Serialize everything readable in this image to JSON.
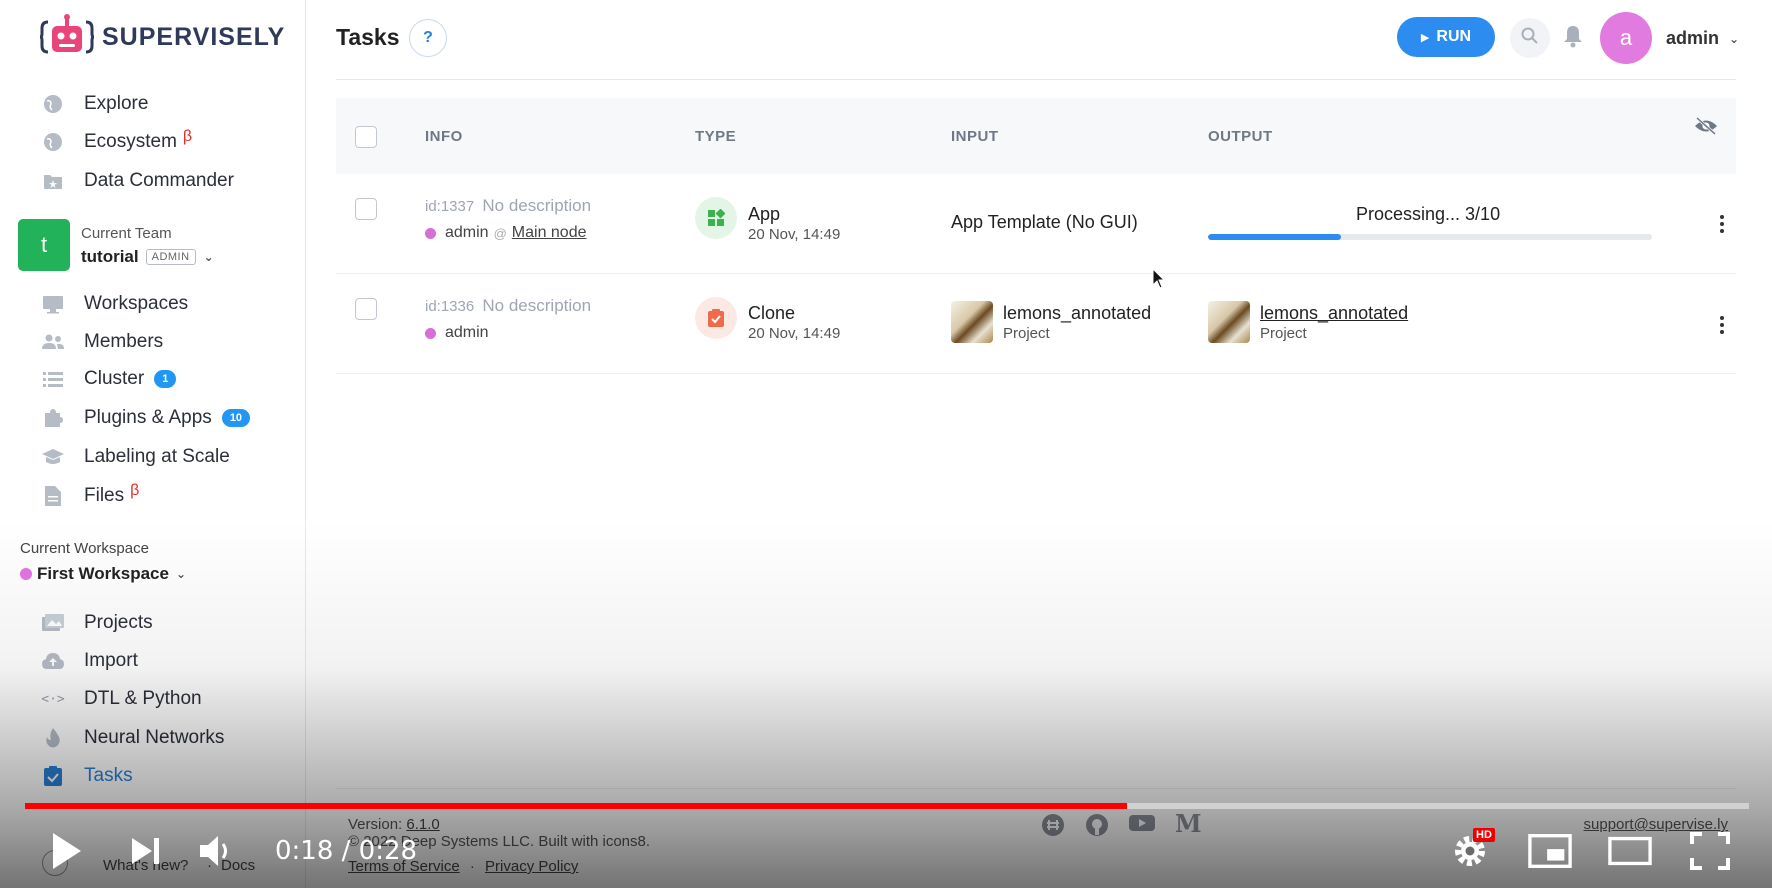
{
  "brand": {
    "name": "SUPERVISELY"
  },
  "nav_top": [
    {
      "label": "Explore",
      "icon": "globe-icon"
    },
    {
      "label": "Ecosystem",
      "icon": "globe-icon",
      "beta": "β"
    },
    {
      "label": "Data Commander",
      "icon": "folder-star-icon"
    }
  ],
  "team": {
    "caption": "Current Team",
    "name": "tutorial",
    "role": "ADMIN",
    "avatar": "t"
  },
  "nav_team": [
    {
      "label": "Workspaces",
      "icon": "monitor-icon"
    },
    {
      "label": "Members",
      "icon": "people-icon"
    },
    {
      "label": "Cluster",
      "icon": "list-icon",
      "count": "1"
    },
    {
      "label": "Plugins & Apps",
      "icon": "puzzle-icon",
      "count": "10"
    },
    {
      "label": "Labeling at Scale",
      "icon": "graduation-cap-icon"
    },
    {
      "label": "Files",
      "icon": "file-icon",
      "beta": "β"
    }
  ],
  "workspace": {
    "caption": "Current Workspace",
    "name": "First Workspace"
  },
  "nav_ws": [
    {
      "label": "Projects",
      "icon": "images-icon"
    },
    {
      "label": "Import",
      "icon": "cloud-upload-icon"
    },
    {
      "label": "DTL & Python",
      "icon": "code-icon"
    },
    {
      "label": "Neural Networks",
      "icon": "flame-icon"
    },
    {
      "label": "Tasks",
      "icon": "clipboard-check-icon",
      "active": true
    }
  ],
  "sidebar_footer": {
    "whats_new": "What's new?",
    "sep": "·",
    "docs": "Docs"
  },
  "header": {
    "title": "Tasks",
    "help": "?",
    "run_label": "RUN",
    "avatar": "a",
    "user": "admin"
  },
  "table": {
    "columns": [
      "INFO",
      "TYPE",
      "INPUT",
      "OUTPUT"
    ],
    "rows": [
      {
        "id": "id:1337",
        "description": "No description",
        "user": "admin",
        "node": "Main node",
        "type": "App",
        "date": "20 Nov, 14:49",
        "input": "App Template (No GUI)",
        "output_status": "Processing... 3/10",
        "progress": 0.3
      },
      {
        "id": "id:1336",
        "description": "No description",
        "user": "admin",
        "type": "Clone",
        "date": "20 Nov, 14:49",
        "input_project": "lemons_annotated",
        "input_sub": "Project",
        "output_project": "lemons_annotated",
        "output_sub": "Project"
      }
    ]
  },
  "footer": {
    "version_label": "Version:",
    "version": "6.1.0",
    "copyright": "© 2022 Deep Systems LLC. Built with icons8.",
    "terms": "Terms of Service",
    "dot": "·",
    "privacy": "Privacy Policy",
    "support": "support@supervise.ly"
  },
  "video": {
    "time": "0:18 / 0:28",
    "played": 0.639,
    "hd": "HD"
  }
}
